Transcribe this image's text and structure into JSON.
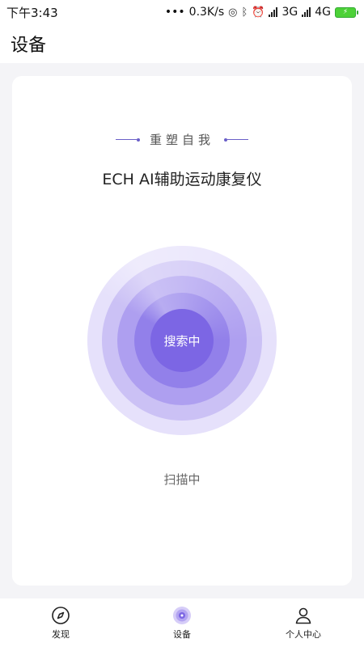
{
  "status_bar": {
    "time": "下午3:43",
    "more": "•••",
    "speed": "0.3K/s",
    "network_3g": "3G",
    "network_4g": "4G"
  },
  "header": {
    "title": "设备"
  },
  "card": {
    "tagline": "重塑自我",
    "device_name": "ECH AI辅助运动康复仪",
    "radar_label": "搜索中",
    "scan_status": "扫描中"
  },
  "tabbar": {
    "items": [
      {
        "label": "发现",
        "icon": "compass-icon"
      },
      {
        "label": "设备",
        "icon": "device-radar-icon"
      },
      {
        "label": "个人中心",
        "icon": "user-icon"
      }
    ]
  },
  "colors": {
    "accent": "#7c66e4",
    "ring_outer": "#e6e1fb",
    "ring_inner": "#7c66e4",
    "background": "#f4f4f7"
  }
}
